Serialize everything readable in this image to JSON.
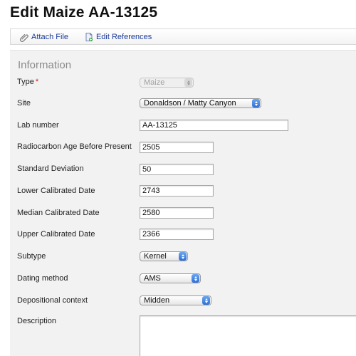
{
  "page": {
    "title": "Edit Maize AA-13125"
  },
  "toolbar": {
    "attach_file": {
      "label": "Attach File",
      "icon": "paperclip-icon"
    },
    "edit_references": {
      "label": "Edit References",
      "icon": "document-icon"
    }
  },
  "form": {
    "section_title": "Information",
    "type": {
      "label": "Type",
      "required_mark": "*",
      "value": "Maize",
      "disabled": true
    },
    "site": {
      "label": "Site",
      "value": "Donaldson / Matty Canyon"
    },
    "lab_number": {
      "label": "Lab number",
      "value": "AA-13125"
    },
    "radiocarbon_age": {
      "label": "Radiocarbon Age Before Present",
      "value": "2505"
    },
    "standard_deviation": {
      "label": "Standard Deviation",
      "value": "50"
    },
    "lower_calibrated": {
      "label": "Lower Calibrated Date",
      "value": "2743"
    },
    "median_calibrated": {
      "label": "Median Calibrated Date",
      "value": "2580"
    },
    "upper_calibrated": {
      "label": "Upper Calibrated Date",
      "value": "2366"
    },
    "subtype": {
      "label": "Subtype",
      "value": "Kernel"
    },
    "dating_method": {
      "label": "Dating method",
      "value": "AMS"
    },
    "depositional_context": {
      "label": "Depositional context",
      "value": "Midden"
    },
    "description": {
      "label": "Description",
      "value": ""
    }
  },
  "colors": {
    "link": "#1a3a99",
    "required": "#d21c1c",
    "panel_bg": "#f2f2f2",
    "section_title": "#8a8a8a"
  }
}
